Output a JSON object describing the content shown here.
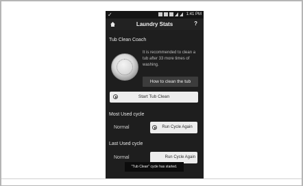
{
  "status_bar": {
    "time": "1:41 PM",
    "left_icon": "check-icon",
    "icons": [
      "cast-icon",
      "vibrate-icon",
      "sim-icon",
      "wifi-icon",
      "signal-icon"
    ]
  },
  "title_bar": {
    "title": "Laundry Stats",
    "help": "?",
    "home_icon": "home-icon"
  },
  "tub_clean": {
    "section_title": "Tub Clean Coach",
    "message": "It is recommended to clean a tub after 33 more times of washing.",
    "how_button": "How to clean the tub",
    "start_button": "Start Tub Clean"
  },
  "most_used": {
    "section_title": "Most Used cycle",
    "cycle": "Normal",
    "run_button": "Run Cycle Again"
  },
  "last_used": {
    "section_title": "Last Used cycle",
    "cycle": "Normal",
    "run_button": "Run Cycle Again"
  },
  "toast": "\"Tub Clean\" cycle has started.",
  "colors": {
    "background": "#1e1e1e",
    "button_light": "#ededed",
    "button_dark": "#3c3c3c"
  }
}
